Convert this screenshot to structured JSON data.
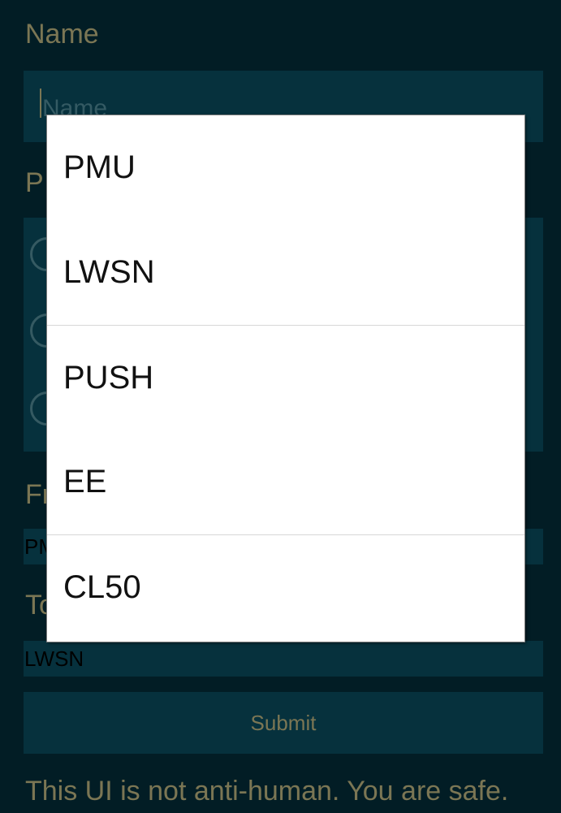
{
  "form": {
    "name_label": "Name",
    "name_placeholder": "Name",
    "protocol_label": "P",
    "from_label": "Fr",
    "from_value": "PM",
    "to_label": "To",
    "to_value": "LWSN",
    "submit_label": "Submit",
    "footer_text": "This UI is not anti-human. You are safe."
  },
  "dropdown": {
    "options": [
      {
        "label": "PMU"
      },
      {
        "label": "LWSN"
      },
      {
        "label": "PUSH"
      },
      {
        "label": "EE"
      },
      {
        "label": "CL50"
      }
    ]
  },
  "colors": {
    "background": "#021d25",
    "field": "#06313d",
    "label_text": "#7b7654",
    "dropdown_bg": "#ffffff"
  }
}
